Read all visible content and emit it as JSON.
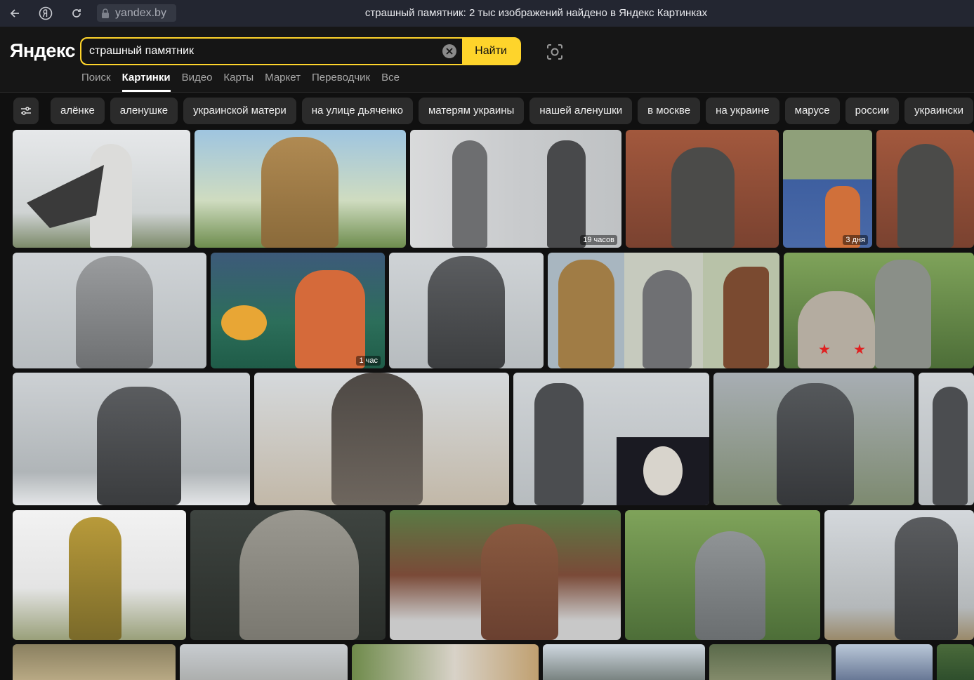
{
  "browser": {
    "address": "yandex.by",
    "tab_title": "страшный памятник: 2 тыс изображений найдено в Яндекс Картинках"
  },
  "header": {
    "logo": "Яндекс",
    "search_value": "страшный памятник",
    "search_button": "Найти",
    "services": [
      {
        "label": "Поиск",
        "active": false
      },
      {
        "label": "Картинки",
        "active": true
      },
      {
        "label": "Видео",
        "active": false
      },
      {
        "label": "Карты",
        "active": false
      },
      {
        "label": "Маркет",
        "active": false
      },
      {
        "label": "Переводчик",
        "active": false
      },
      {
        "label": "Все",
        "active": false
      }
    ]
  },
  "chips": [
    "алёнке",
    "аленушке",
    "украинской матери",
    "на улице дьяченко",
    "матерям украины",
    "нашей аленушки",
    "в москве",
    "на украине",
    "марусе",
    "россии",
    "украински"
  ],
  "badges": {
    "t3": "19 часов",
    "t5": "3 дня",
    "t8": "1 час"
  },
  "icons": {
    "back": "arrow-left-icon",
    "yandex": "yandex-browser-icon",
    "reload": "reload-icon",
    "lock": "lock-icon",
    "clear": "clear-icon",
    "lens": "camera-search-icon",
    "filter": "filter-sliders-icon"
  },
  "colors": {
    "accent": "#fed42b",
    "background": "#101010",
    "chip": "#2b2b2b"
  }
}
